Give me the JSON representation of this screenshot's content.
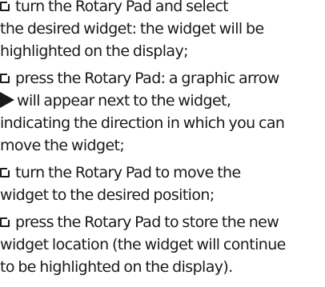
{
  "steps": [
    {
      "lines": [
        "turn the Rotary Pad and select",
        "the desired widget: the widget will be",
        "highlighted on the display;"
      ]
    },
    {
      "lines": [
        "press the Rotary Pad: a graphic arrow",
        "will appear next to the widget,",
        "indicating the direction in which you can",
        "move the widget;"
      ]
    },
    {
      "lines": [
        "turn the Rotary Pad to move the",
        "widget to the desired position;"
      ]
    },
    {
      "lines": [
        "press the Rotary Pad to store the new",
        "widget location (the widget will continue",
        "to be highlighted on the display)."
      ]
    }
  ],
  "icons": {
    "bullet": "checkbox-square-icon",
    "arrow": "triangle-right-arrow-icon"
  }
}
